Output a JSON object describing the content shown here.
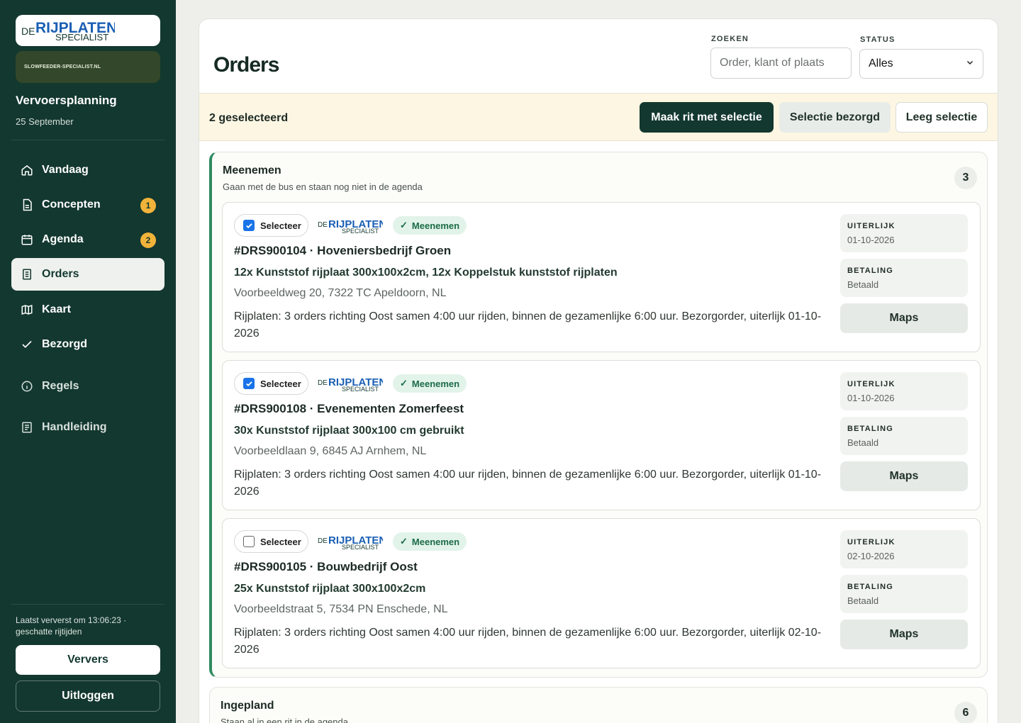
{
  "sidebar": {
    "logo_text": "DE RIJPLATEN SPECIALIST",
    "sub_logo_text": "SLOWFEEDER-SPECIALIST.NL",
    "title": "Vervoersplanning",
    "date": "25 September",
    "nav": [
      {
        "label": "Vandaag",
        "icon": "home-icon"
      },
      {
        "label": "Concepten",
        "icon": "document-icon",
        "badge": "1"
      },
      {
        "label": "Agenda",
        "icon": "calendar-icon",
        "badge": "2"
      },
      {
        "label": "Orders",
        "icon": "list-icon",
        "active": true
      },
      {
        "label": "Kaart",
        "icon": "map-icon"
      },
      {
        "label": "Bezorgd",
        "icon": "check-icon"
      },
      {
        "label": "Regels",
        "icon": "info-icon"
      },
      {
        "label": "Handleiding",
        "icon": "manual-icon"
      }
    ],
    "refresh_text": "Laatst ververst om 13:06:23 · geschatte rijtijden",
    "refresh_button": "Ververs",
    "logout_button": "Uitloggen"
  },
  "header": {
    "title": "Orders",
    "search_label": "ZOEKEN",
    "search_placeholder": "Order, klant of plaats",
    "status_label": "STATUS",
    "status_value": "Alles"
  },
  "selection": {
    "count": "2 geselecteerd",
    "make_trip": "Maak rit met selectie",
    "mark_delivered": "Selectie bezorgd",
    "clear": "Leeg selectie"
  },
  "groups": [
    {
      "title": "Meenemen",
      "subtitle": "Gaan met de bus en staan nog niet in de agenda",
      "count": "3",
      "orders": [
        {
          "select_label": "Selecteer",
          "checked": true,
          "status": "Meenemen",
          "title": "#DRS900104 · Hoveniersbedrijf Groen",
          "products": "12x Kunststof rijplaat 300x100x2cm, 12x Koppelstuk kunststof rijplaten",
          "address": "Voorbeeldweg 20, 7322 TC Apeldoorn, NL",
          "note": "Rijplaten: 3 orders richting Oost samen 4:00 uur rijden, binnen de gezamenlijke 6:00 uur. Bezorgorder, uiterlijk 01-10-2026",
          "deadline_label": "UITERLIJK",
          "deadline": "01-10-2026",
          "payment_label": "BETALING",
          "payment": "Betaald",
          "maps": "Maps"
        },
        {
          "select_label": "Selecteer",
          "checked": true,
          "status": "Meenemen",
          "title": "#DRS900108 · Evenementen Zomerfeest",
          "products": "30x Kunststof rijplaat 300x100 cm gebruikt",
          "address": "Voorbeeldlaan 9, 6845 AJ Arnhem, NL",
          "note": "Rijplaten: 3 orders richting Oost samen 4:00 uur rijden, binnen de gezamenlijke 6:00 uur. Bezorgorder, uiterlijk 01-10-2026",
          "deadline_label": "UITERLIJK",
          "deadline": "01-10-2026",
          "payment_label": "BETALING",
          "payment": "Betaald",
          "maps": "Maps"
        },
        {
          "select_label": "Selecteer",
          "checked": false,
          "status": "Meenemen",
          "title": "#DRS900105 · Bouwbedrijf Oost",
          "products": "25x Kunststof rijplaat 300x100x2cm",
          "address": "Voorbeeldstraat 5, 7534 PN Enschede, NL",
          "note": "Rijplaten: 3 orders richting Oost samen 4:00 uur rijden, binnen de gezamenlijke 6:00 uur. Bezorgorder, uiterlijk 02-10-2026",
          "deadline_label": "UITERLIJK",
          "deadline": "02-10-2026",
          "payment_label": "BETALING",
          "payment": "Betaald",
          "maps": "Maps"
        }
      ]
    },
    {
      "title": "Ingepland",
      "subtitle": "Staan al in een rit in de agenda",
      "count": "6"
    }
  ],
  "colors": {
    "sidebar_bg": "#13382f",
    "accent_green": "#2e8a5f",
    "badge_yellow": "#f2b33a",
    "selection_bar": "#fdf6e3",
    "brand_blue": "#1a5fb4"
  }
}
